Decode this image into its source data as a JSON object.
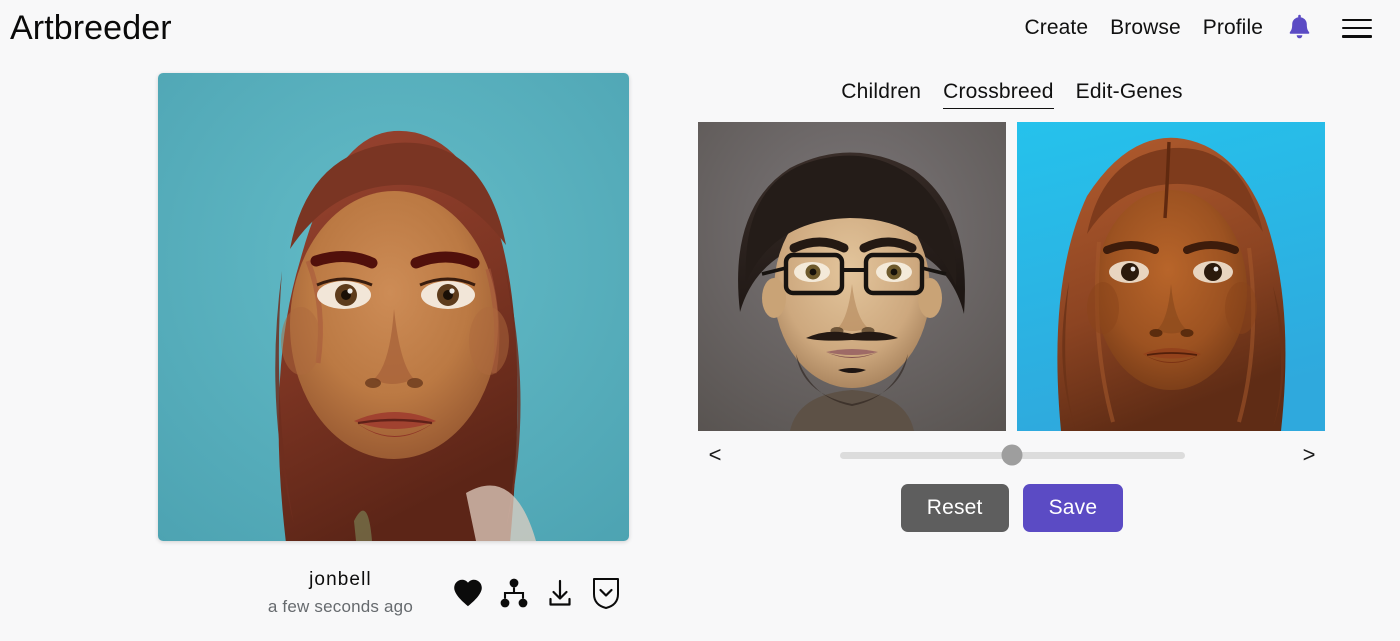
{
  "header": {
    "brand": "Artbreeder",
    "nav": [
      {
        "label": "Create",
        "name": "nav-create"
      },
      {
        "label": "Browse",
        "name": "nav-browse"
      },
      {
        "label": "Profile",
        "name": "nav-profile"
      }
    ],
    "bell_icon": "notification-bell-icon",
    "bell_color": "#5b4bc4",
    "menu_icon": "hamburger-menu-icon"
  },
  "main_image": {
    "alt": "portrait of a woman with reddish-brown hair on teal background",
    "background_color": "#58b2c0",
    "hair_color": "#8a3a28",
    "skin_color": "#c07b4a"
  },
  "meta": {
    "username": "jonbell",
    "timestamp": "a few seconds ago",
    "icons": [
      {
        "name": "heart-icon",
        "label": "Like"
      },
      {
        "name": "lineage-tree-icon",
        "label": "Lineage"
      },
      {
        "name": "download-icon",
        "label": "Download"
      },
      {
        "name": "shield-chevron-down-icon",
        "label": "More"
      }
    ]
  },
  "panel": {
    "tabs": [
      {
        "label": "Children",
        "active": false
      },
      {
        "label": "Crossbreed",
        "active": true
      },
      {
        "label": "Edit-Genes",
        "active": false
      }
    ],
    "parents": [
      {
        "name": "parent-left",
        "alt": "portrait of a man with glasses, dark hair and mustache on gray background",
        "background_color": "#6a6668",
        "hair_color": "#2a2220",
        "skin_color": "#d8b890"
      },
      {
        "name": "parent-right",
        "alt": "portrait of a young woman with auburn hair on bright cyan background",
        "background_color": "#29bde8",
        "hair_color": "#a04f2a",
        "skin_color": "#a8561f"
      }
    ],
    "slider": {
      "prev_label": "<",
      "next_label": ">",
      "value": 50,
      "min": 0,
      "max": 100,
      "track_color": "#dcdcdc",
      "thumb_color": "#9e9e9e"
    },
    "buttons": {
      "reset_label": "Reset",
      "reset_color": "#5e5e5e",
      "save_label": "Save",
      "save_color": "#5b4bc4"
    }
  }
}
